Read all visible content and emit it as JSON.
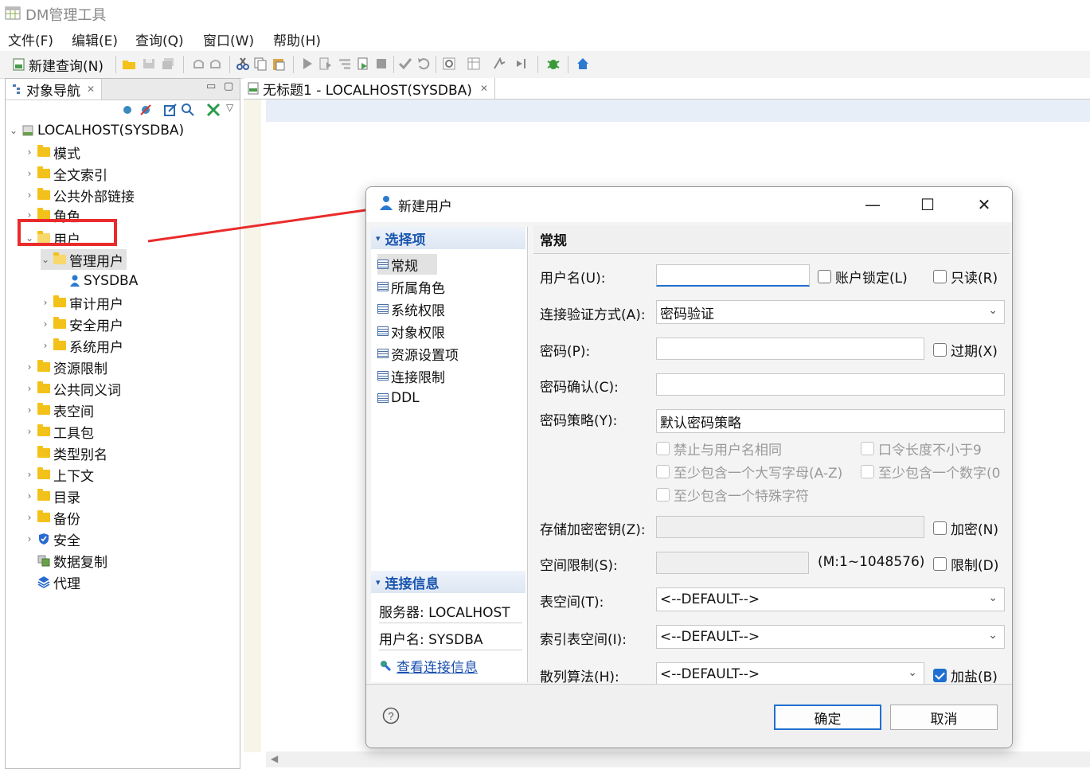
{
  "app": {
    "title": "DM管理工具"
  },
  "menu": [
    "文件(F)",
    "编辑(E)",
    "查询(Q)",
    "窗口(W)",
    "帮助(H)"
  ],
  "toolbar": {
    "new_query": "新建查询(N)"
  },
  "nav": {
    "tab_label": "对象导航",
    "tree": [
      {
        "label": "LOCALHOST(SYSDBA)"
      },
      {
        "label": "模式"
      },
      {
        "label": "全文索引"
      },
      {
        "label": "公共外部链接"
      },
      {
        "label": "角色"
      },
      {
        "label": "用户"
      },
      {
        "label": "管理用户"
      },
      {
        "label": "SYSDBA"
      },
      {
        "label": "审计用户"
      },
      {
        "label": "安全用户"
      },
      {
        "label": "系统用户"
      },
      {
        "label": "资源限制"
      },
      {
        "label": "公共同义词"
      },
      {
        "label": "表空间"
      },
      {
        "label": "工具包"
      },
      {
        "label": "类型别名"
      },
      {
        "label": "上下文"
      },
      {
        "label": "目录"
      },
      {
        "label": "备份"
      },
      {
        "label": "安全"
      },
      {
        "label": "数据复制"
      },
      {
        "label": "代理"
      }
    ]
  },
  "editor": {
    "tab_label": "无标题1 - LOCALHOST(SYSDBA)"
  },
  "dialog": {
    "title": "新建用户",
    "options_header": "选择项",
    "options": [
      "常规",
      "所属角色",
      "系统权限",
      "对象权限",
      "资源设置项",
      "连接限制",
      "DDL"
    ],
    "conn_header": "连接信息",
    "server": "服务器: LOCALHOST",
    "username_info": "用户名: SYSDBA",
    "view_conn_link": "查看连接信息",
    "section_title": "常规",
    "fields": {
      "username_label": "用户名(U):",
      "username_value": "",
      "account_lock": "账户锁定(L)",
      "readonly": "只读(R)",
      "auth_label": "连接验证方式(A):",
      "auth_value": "密码验证",
      "password_label": "密码(P):",
      "expire": "过期(X)",
      "confirm_label": "密码确认(C):",
      "policy_label": "密码策略(Y):",
      "policy_value": "默认密码策略",
      "policy_opt1": "禁止与用户名相同",
      "policy_opt2": "口令长度不小于9",
      "policy_opt3": "至少包含一个大写字母(A-Z)",
      "policy_opt4": "至少包含一个数字(0",
      "policy_opt5": "至少包含一个特殊字符",
      "enc_key_label": "存储加密密钥(Z):",
      "encrypt": "加密(N)",
      "space_label": "空间限制(S):",
      "space_range": "(M:1~1048576)",
      "limit": "限制(D)",
      "tablespace_label": "表空间(T):",
      "tablespace_value": "<--DEFAULT-->",
      "index_ts_label": "索引表空间(I):",
      "index_ts_value": "<--DEFAULT-->",
      "hash_label": "散列算法(H):",
      "hash_value": "<--DEFAULT-->",
      "salt": "加盐(B)"
    },
    "ok": "确定",
    "cancel": "取消"
  },
  "colors": {
    "accent": "#1f6fd0",
    "annotation": "#ea2b2b",
    "folder": "#f3c21a"
  }
}
